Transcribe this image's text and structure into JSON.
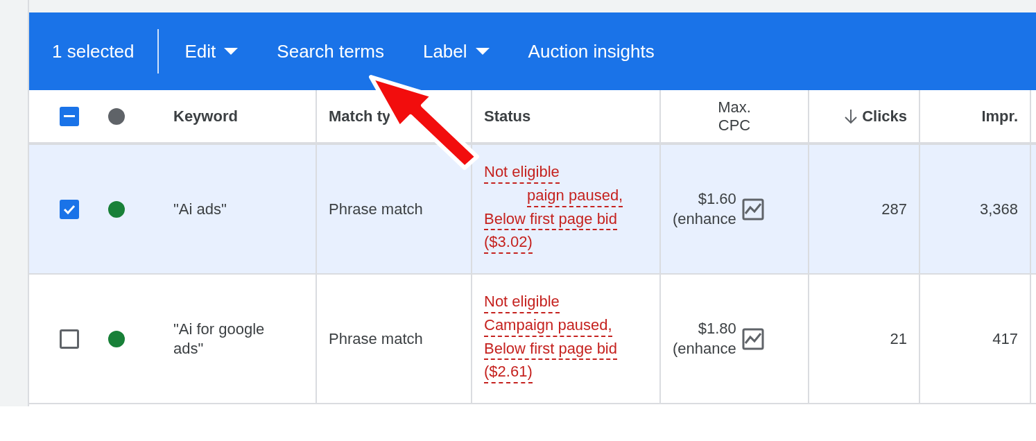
{
  "toolbar": {
    "selection_count": "1 selected",
    "actions": [
      {
        "label": "Edit",
        "dropdown": true
      },
      {
        "label": "Search terms",
        "dropdown": false
      },
      {
        "label": "Label",
        "dropdown": true
      },
      {
        "label": "Auction insights",
        "dropdown": false
      }
    ]
  },
  "header": {
    "select_all": {
      "checked": true,
      "indeterminate": true
    },
    "status_dot": {
      "color": "#5f6368"
    },
    "columns": [
      {
        "label": "Keyword",
        "sorted": false
      },
      {
        "label": "Match ty",
        "sorted": false
      },
      {
        "label": "Status",
        "sorted": false
      },
      {
        "label": "Max. CPC",
        "sorted": false
      },
      {
        "label": "Clicks",
        "sorted": true
      },
      {
        "label": "Impr.",
        "sorted": false
      }
    ]
  },
  "rows": [
    {
      "selected": true,
      "color": "#188038",
      "keyword": "\"Ai ads\"",
      "match_type": "Phrase match",
      "status_lines": [
        {
          "text": "Not eligible",
          "kind": "full"
        },
        {
          "text": "paign paused,",
          "kind": "partial"
        },
        {
          "text": "Below first page bid",
          "kind": "full"
        },
        {
          "text": "($3.02)",
          "kind": "full"
        }
      ],
      "max_cpc": "$1.60",
      "cpc_note": "(enhance",
      "clicks": "287",
      "impr": "3,368"
    },
    {
      "selected": false,
      "color": "#188038",
      "keyword": "\"Ai for google ads\"",
      "match_type": "Phrase match",
      "status_lines": [
        {
          "text": "Not eligible",
          "kind": "full"
        },
        {
          "text": "Campaign paused,",
          "kind": "full"
        },
        {
          "text": "Below first page bid",
          "kind": "full"
        },
        {
          "text": "($2.61)",
          "kind": "full"
        }
      ],
      "max_cpc": "$1.80",
      "cpc_note": "(enhance",
      "clicks": "21",
      "impr": "417"
    }
  ]
}
